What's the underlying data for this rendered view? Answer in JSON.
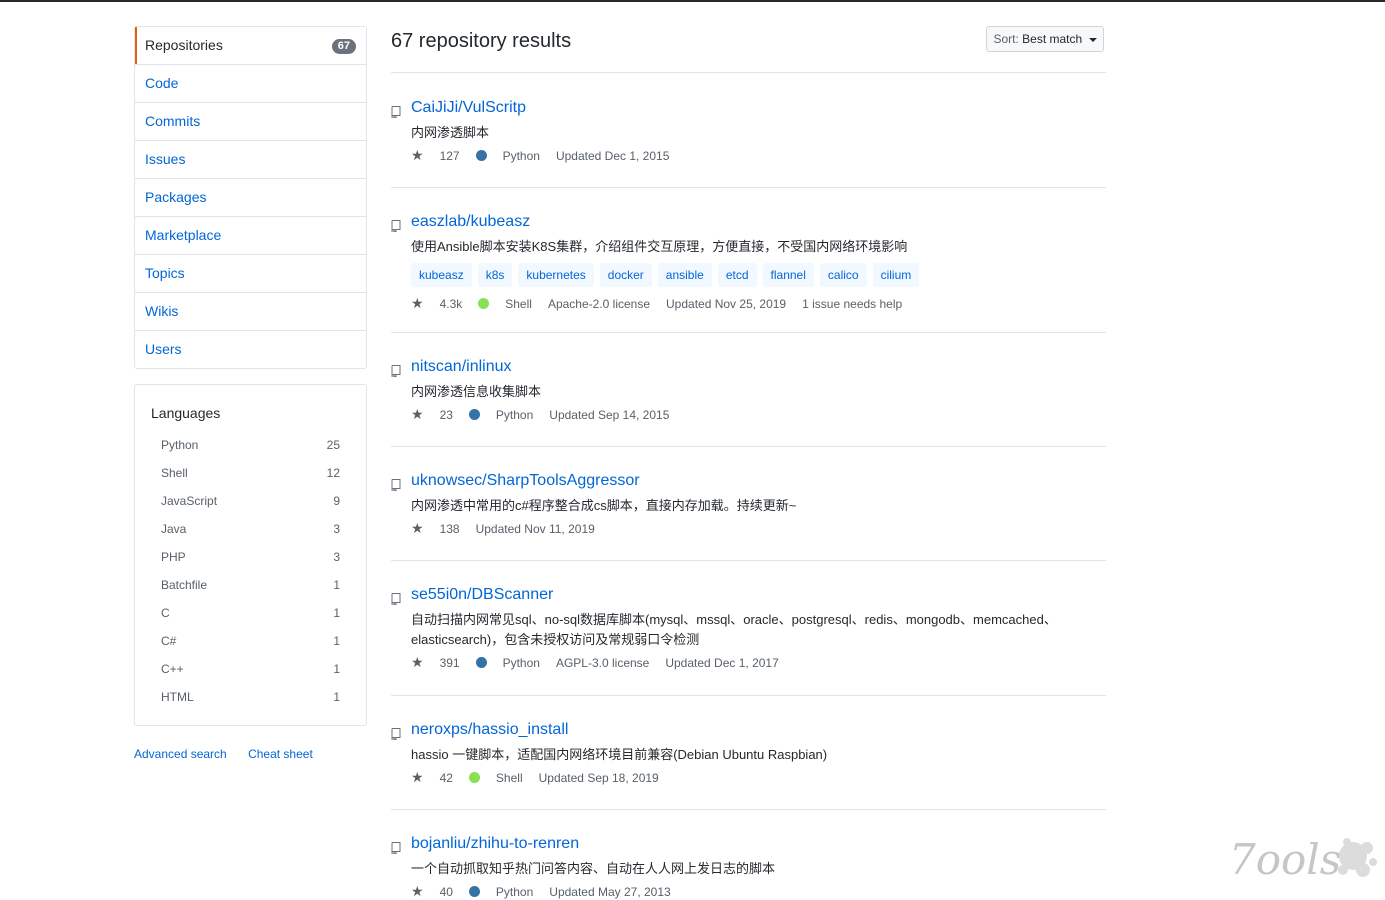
{
  "nav": {
    "items": [
      {
        "label": "Repositories",
        "count": "67",
        "selected": true
      },
      {
        "label": "Code"
      },
      {
        "label": "Commits"
      },
      {
        "label": "Issues"
      },
      {
        "label": "Packages"
      },
      {
        "label": "Marketplace"
      },
      {
        "label": "Topics"
      },
      {
        "label": "Wikis"
      },
      {
        "label": "Users"
      }
    ]
  },
  "languages": {
    "title": "Languages",
    "items": [
      {
        "name": "Python",
        "count": "25"
      },
      {
        "name": "Shell",
        "count": "12"
      },
      {
        "name": "JavaScript",
        "count": "9"
      },
      {
        "name": "Java",
        "count": "3"
      },
      {
        "name": "PHP",
        "count": "3"
      },
      {
        "name": "Batchfile",
        "count": "1"
      },
      {
        "name": "C",
        "count": "1"
      },
      {
        "name": "C#",
        "count": "1"
      },
      {
        "name": "C++",
        "count": "1"
      },
      {
        "name": "HTML",
        "count": "1"
      }
    ]
  },
  "footer": {
    "advanced_search": "Advanced search",
    "cheat_sheet": "Cheat sheet"
  },
  "results": {
    "title": "67 repository results"
  },
  "sort": {
    "label": "Sort:",
    "value": "Best match"
  },
  "lang_colors": {
    "Python": "#3572A5",
    "Shell": "#89e051"
  },
  "repos": [
    {
      "name": "CaiJiJi/VulScritp",
      "description": "内网渗透脚本",
      "topics": [],
      "stars": "127",
      "language": "Python",
      "license": "",
      "updated": "Updated Dec 1, 2015",
      "issues": ""
    },
    {
      "name": "easzlab/kubeasz",
      "description": "使用Ansible脚本安装K8S集群，介绍组件交互原理，方便直接，不受国内网络环境影响",
      "topics": [
        "kubeasz",
        "k8s",
        "kubernetes",
        "docker",
        "ansible",
        "etcd",
        "flannel",
        "calico",
        "cilium"
      ],
      "stars": "4.3k",
      "language": "Shell",
      "license": "Apache-2.0 license",
      "updated": "Updated Nov 25, 2019",
      "issues": "1 issue needs help"
    },
    {
      "name": "nitscan/inlinux",
      "description": "内网渗透信息收集脚本",
      "topics": [],
      "stars": "23",
      "language": "Python",
      "license": "",
      "updated": "Updated Sep 14, 2015",
      "issues": ""
    },
    {
      "name": "uknowsec/SharpToolsAggressor",
      "description": "内网渗透中常用的c#程序整合成cs脚本，直接内存加载。持续更新~",
      "topics": [],
      "stars": "138",
      "language": "",
      "license": "",
      "updated": "Updated Nov 11, 2019",
      "issues": ""
    },
    {
      "name": "se55i0n/DBScanner",
      "description": "自动扫描内网常见sql、no-sql数据库脚本(mysql、mssql、oracle、postgresql、redis、mongodb、memcached、elasticsearch)，包含未授权访问及常规弱口令检测",
      "topics": [],
      "stars": "391",
      "language": "Python",
      "license": "AGPL-3.0 license",
      "updated": "Updated Dec 1, 2017",
      "issues": ""
    },
    {
      "name": "neroxps/hassio_install",
      "description": "hassio 一键脚本，适配国内网络环境目前兼容(Debian Ubuntu Raspbian)",
      "topics": [],
      "stars": "42",
      "language": "Shell",
      "license": "",
      "updated": "Updated Sep 18, 2019",
      "issues": ""
    },
    {
      "name": "bojanliu/zhihu-to-renren",
      "description": "一个自动抓取知乎热门问答内容、自动在人人网上发日志的脚本",
      "topics": [],
      "stars": "40",
      "language": "Python",
      "license": "",
      "updated": "Updated May 27, 2013",
      "issues": ""
    }
  ],
  "watermark": {
    "text": "7ools"
  }
}
